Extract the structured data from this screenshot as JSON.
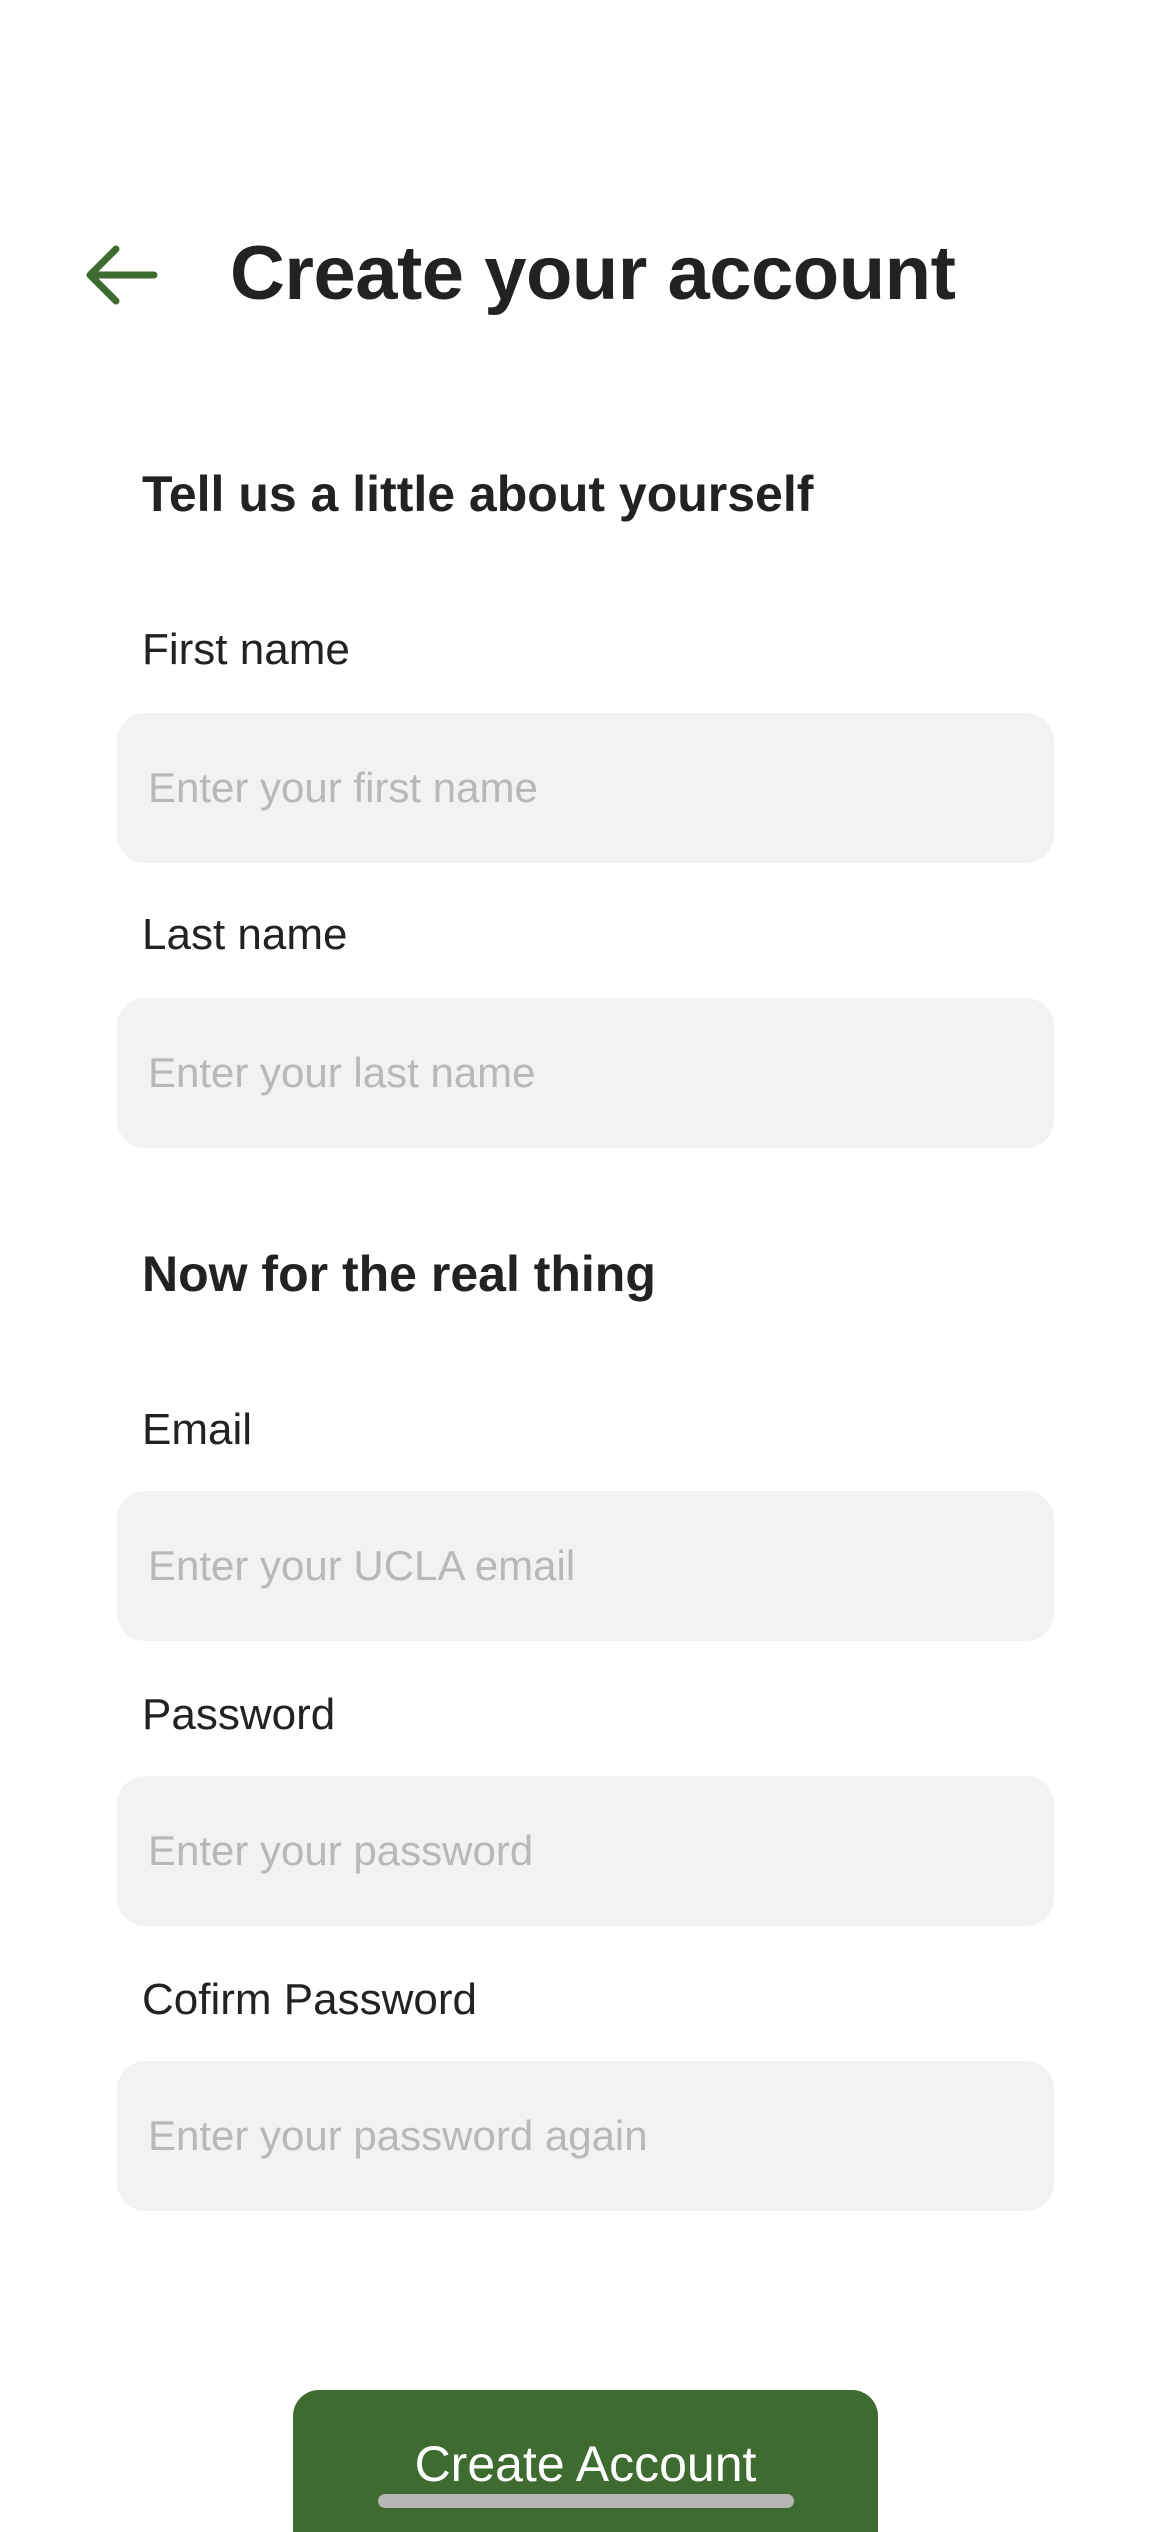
{
  "header": {
    "title": "Create your account",
    "back_icon": "arrow-left-icon",
    "accent_color": "#3e6b30"
  },
  "sections": {
    "about": {
      "heading": "Tell us a little about yourself",
      "first_name": {
        "label": "First name",
        "value": "",
        "placeholder": "Enter your first name"
      },
      "last_name": {
        "label": "Last name",
        "value": "",
        "placeholder": "Enter your last name"
      }
    },
    "account": {
      "heading": "Now for the real thing",
      "email": {
        "label": "Email",
        "value": "",
        "placeholder": "Enter your UCLA email"
      },
      "password": {
        "label": "Password",
        "value": "",
        "placeholder": "Enter your password"
      },
      "confirm_password": {
        "label": "Cofirm Password",
        "value": "",
        "placeholder": "Enter your password again"
      }
    }
  },
  "actions": {
    "submit_label": "Create Account",
    "submit_color": "#3e6b30"
  }
}
